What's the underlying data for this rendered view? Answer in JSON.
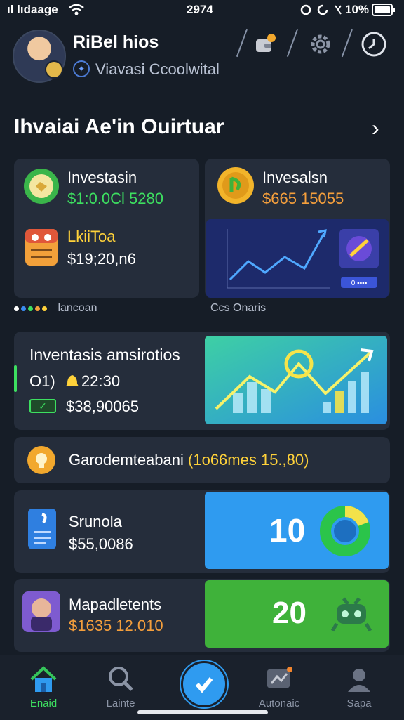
{
  "status_bar": {
    "carrier": "ıl lıdaage",
    "time": "2974",
    "battery": "10%"
  },
  "header": {
    "username": "RiBel hios",
    "subtitle": "Viavasi Ccoolwital"
  },
  "section": {
    "title": "Ihvaiai Ae'in Ouirtuar"
  },
  "card_left": {
    "item1": {
      "label": "Investasin",
      "value": "$1:0.0Cl 5280"
    },
    "item2": {
      "label": "LkiiToa",
      "value": "$19;20,n6"
    },
    "legend": "lancoan"
  },
  "card_right": {
    "label": "Invesalsn",
    "value": "$665 15055",
    "caption": "Ccs Onaris",
    "mini_button": "0 ▪▪▪▪"
  },
  "card_inventory": {
    "title": "Inventasis amsirotios",
    "meta_left": "O1)",
    "meta_time": "22:30",
    "value": "$38,90065"
  },
  "card_banner": {
    "text": "Garodemteabani",
    "highlight": "(1o66mes 15.,80)"
  },
  "card_srunola": {
    "label": "Srunola",
    "value": "$55,0086",
    "stat": "10"
  },
  "card_mapad": {
    "label": "Mapadletents",
    "value": "$1635 12.010",
    "stat": "20"
  },
  "nav": [
    {
      "label": "Enaid",
      "icon": "home-icon",
      "active": true
    },
    {
      "label": "Lainte",
      "icon": "search-icon",
      "active": false
    },
    {
      "label": "",
      "icon": "check-icon",
      "active": false
    },
    {
      "label": "Autonaic",
      "icon": "chart-icon",
      "active": false
    },
    {
      "label": "Sapa",
      "icon": "profile-icon",
      "active": false
    }
  ],
  "colors": {
    "bg": "#161d27",
    "card": "#252d3b",
    "accent_blue": "#2f9bf0",
    "accent_green": "#3fb23a",
    "gain_green": "#3ddf60",
    "orange": "#f59f3c"
  }
}
